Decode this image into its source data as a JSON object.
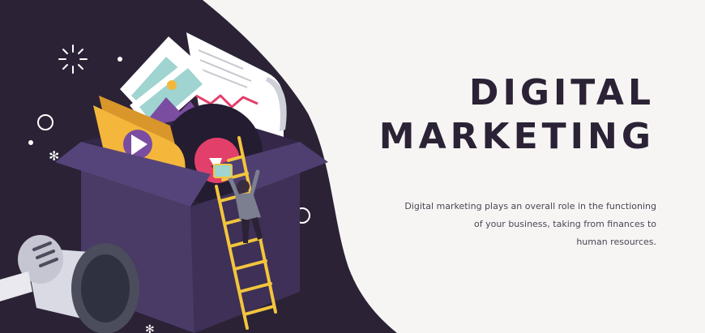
{
  "banner": {
    "title_lines": [
      "DIGITAL",
      "MARKETING"
    ],
    "description_lines": [
      "Digital marketing plays an overall role in the functioning",
      "of your business, taking from finances to",
      "human resources."
    ]
  },
  "colors": {
    "background": "#f7f5f3",
    "dark_panel": "#2b2236",
    "box": "#3e3056",
    "folder": "#f4b73c",
    "accent_pink": "#e23f6b",
    "ladder": "#f2c53d",
    "photo_card": "#9fd4d0"
  },
  "icons": [
    "sparkle-icon",
    "asterisk-icon",
    "circle-outline-icon",
    "play-icon",
    "megaphone-icon",
    "trend-chart-icon",
    "ladder-icon",
    "person-icon"
  ]
}
